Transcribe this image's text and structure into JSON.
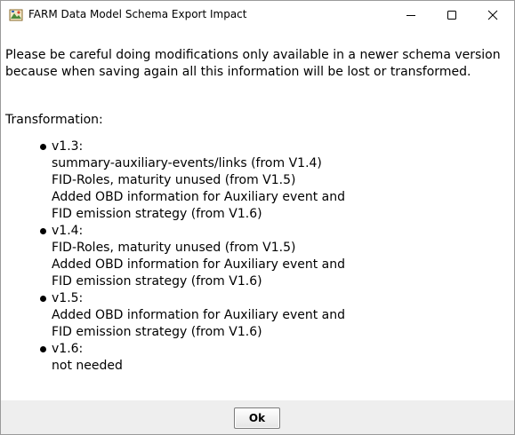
{
  "window": {
    "title": "FARM Data Model Schema Export Impact",
    "icon": "farm-app-icon",
    "controls": [
      "minimize-icon",
      "maximize-icon",
      "close-icon"
    ]
  },
  "message": {
    "line1": "Please be careful doing modifications only available in a newer schema version",
    "line2": "because when saving again all this information will be lost or transformed."
  },
  "transformation": {
    "heading": "Transformation:",
    "versions": [
      {
        "label": "v1.3:",
        "lines": [
          "summary-auxiliary-events/links (from V1.4)",
          "FID-Roles, maturity unused (from V1.5)",
          "Added OBD information for Auxiliary event and",
          "FID emission strategy (from V1.6)"
        ]
      },
      {
        "label": "v1.4:",
        "lines": [
          "FID-Roles, maturity unused (from V1.5)",
          "Added OBD information for Auxiliary event and",
          "FID emission strategy (from V1.6)"
        ]
      },
      {
        "label": "v1.5:",
        "lines": [
          "Added OBD information for Auxiliary event and",
          "FID emission strategy (from V1.6)"
        ]
      },
      {
        "label": "v1.6:",
        "lines": [
          "not needed"
        ]
      }
    ]
  },
  "footer": {
    "ok_label": "Ok"
  }
}
